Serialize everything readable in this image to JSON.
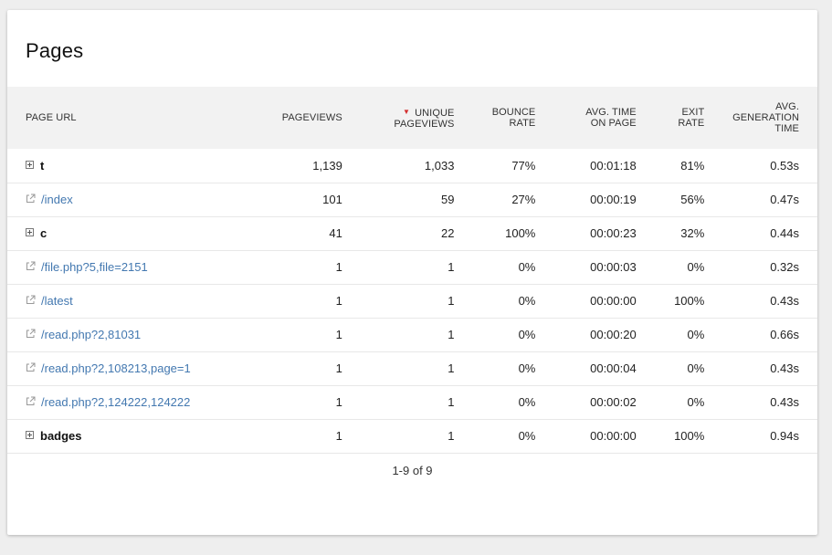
{
  "card": {
    "title": "Pages"
  },
  "table": {
    "columns": {
      "url": "PAGE URL",
      "pageviews": "PAGEVIEWS",
      "unique_line1": "UNIQUE",
      "unique_line2": "PAGEVIEWS",
      "bounce_line1": "BOUNCE",
      "bounce_line2": "RATE",
      "avgtime_line1": "AVG. TIME",
      "avgtime_line2": "ON PAGE",
      "exit_line1": "EXIT",
      "exit_line2": "RATE",
      "gen_line1": "AVG.",
      "gen_line2": "GENERATION",
      "gen_line3": "TIME"
    },
    "sort_indicator_color": "#d32f2f",
    "rows": [
      {
        "type": "folder",
        "icon": "expand-icon",
        "label": "t",
        "pageviews": "1,139",
        "unique": "1,033",
        "bounce": "77%",
        "avgtime": "00:01:18",
        "exit": "81%",
        "gen": "0.53s"
      },
      {
        "type": "link",
        "icon": "external-link-icon",
        "label": "/index",
        "pageviews": "101",
        "unique": "59",
        "bounce": "27%",
        "avgtime": "00:00:19",
        "exit": "56%",
        "gen": "0.47s"
      },
      {
        "type": "folder",
        "icon": "expand-icon",
        "label": "c",
        "pageviews": "41",
        "unique": "22",
        "bounce": "100%",
        "avgtime": "00:00:23",
        "exit": "32%",
        "gen": "0.44s"
      },
      {
        "type": "link",
        "icon": "external-link-icon",
        "label": "/file.php?5,file=2151",
        "pageviews": "1",
        "unique": "1",
        "bounce": "0%",
        "avgtime": "00:00:03",
        "exit": "0%",
        "gen": "0.32s"
      },
      {
        "type": "link",
        "icon": "external-link-icon",
        "label": "/latest",
        "pageviews": "1",
        "unique": "1",
        "bounce": "0%",
        "avgtime": "00:00:00",
        "exit": "100%",
        "gen": "0.43s"
      },
      {
        "type": "link",
        "icon": "external-link-icon",
        "label": "/read.php?2,81031",
        "pageviews": "1",
        "unique": "1",
        "bounce": "0%",
        "avgtime": "00:00:20",
        "exit": "0%",
        "gen": "0.66s"
      },
      {
        "type": "link",
        "icon": "external-link-icon",
        "label": "/read.php?2,108213,page=1",
        "pageviews": "1",
        "unique": "1",
        "bounce": "0%",
        "avgtime": "00:00:04",
        "exit": "0%",
        "gen": "0.43s"
      },
      {
        "type": "link",
        "icon": "external-link-icon",
        "label": "/read.php?2,124222,124222",
        "pageviews": "1",
        "unique": "1",
        "bounce": "0%",
        "avgtime": "00:00:02",
        "exit": "0%",
        "gen": "0.43s"
      },
      {
        "type": "folder",
        "icon": "expand-icon",
        "label": "badges",
        "pageviews": "1",
        "unique": "1",
        "bounce": "0%",
        "avgtime": "00:00:00",
        "exit": "100%",
        "gen": "0.94s"
      }
    ]
  },
  "pagination": {
    "text": "1-9 of 9"
  },
  "colors": {
    "link": "#4378b0",
    "header_bg": "#f2f2f2",
    "page_bg": "#eeeeee"
  }
}
